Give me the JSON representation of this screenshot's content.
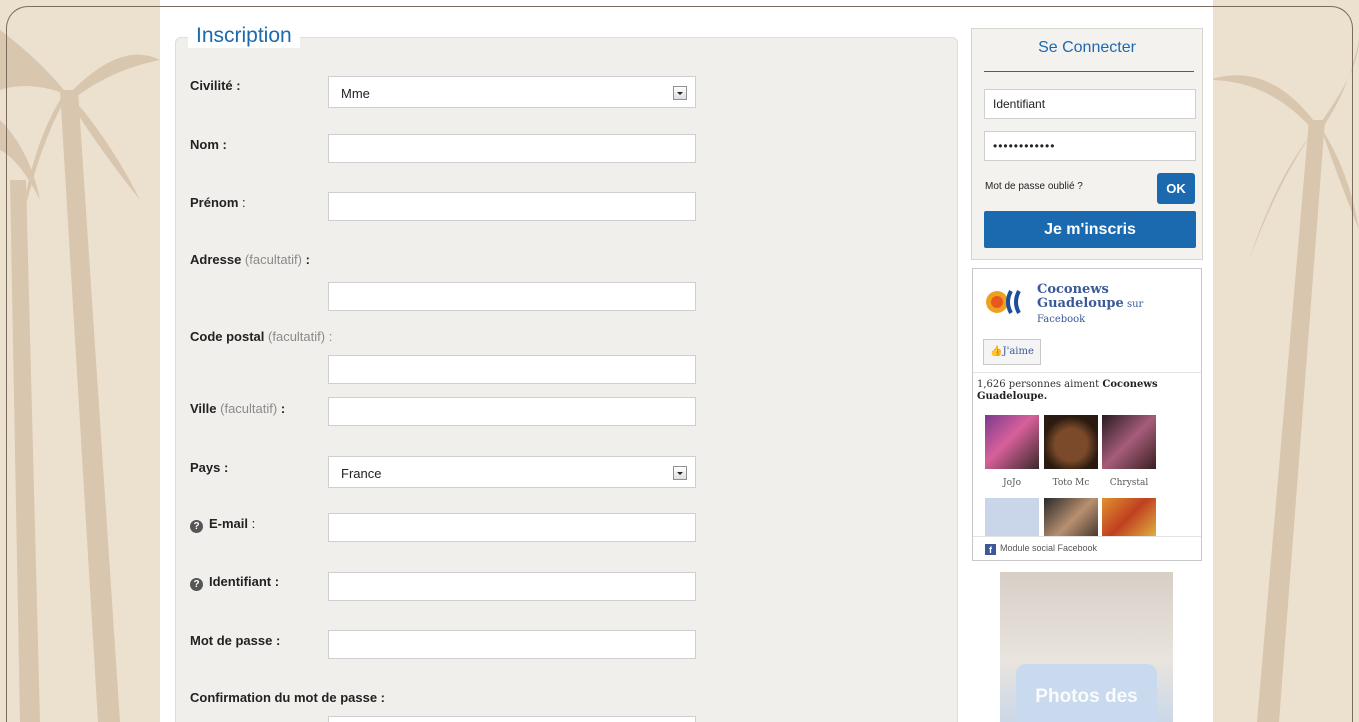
{
  "colors": {
    "accent": "#1b6ab0",
    "background": "#ece0cf",
    "panel": "#f1efec",
    "facebook": "#3b5998"
  },
  "form": {
    "legend": "Inscription",
    "fields": {
      "civilite": {
        "label": "Civilité :",
        "value": "Mme"
      },
      "nom": {
        "label": "Nom :"
      },
      "prenom": {
        "label": "Prénom",
        "suffix": " :"
      },
      "adresse": {
        "label": "Adresse",
        "optional": " (facultatif)",
        "suffix": " :"
      },
      "code_postal": {
        "label": "Code postal",
        "optional": " (facultatif)",
        "suffix": " :"
      },
      "ville": {
        "label": "Ville",
        "optional": " (facultatif)",
        "suffix": " :"
      },
      "pays": {
        "label": "Pays :",
        "value": "France"
      },
      "email": {
        "label": "E-mail",
        "suffix": " :",
        "help_icon": "?"
      },
      "identifiant": {
        "label": "Identifiant :",
        "help_icon": "?"
      },
      "mot_de_passe": {
        "label": "Mot de passe :"
      },
      "confirmation": {
        "label": "Confirmation du mot de passe :"
      }
    }
  },
  "login": {
    "title": "Se Connecter",
    "username_value": "Identifiant",
    "password_value": "••••••••••••",
    "forgot": "Mot de passe oublié ?",
    "ok_label": "OK",
    "signup_label": "Je m'inscris"
  },
  "facebook": {
    "page_name": "Coconews Guadeloupe",
    "on": " sur",
    "network": "Facebook",
    "like_label": "J'aime",
    "likes_text": "1,626 personnes aiment ",
    "likes_page": "Coconews Guadeloupe.",
    "friends": [
      "JoJo",
      "Toto Mc",
      "Chrystal"
    ],
    "footer": "Module social Facebook",
    "footer_icon": "f"
  },
  "ad": {
    "text": "Photos des"
  }
}
